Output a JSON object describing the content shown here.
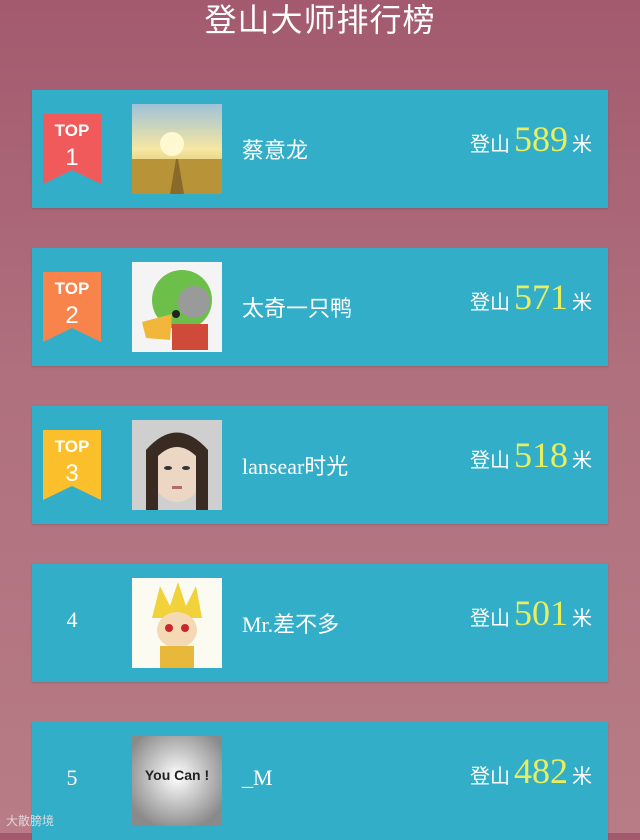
{
  "page_title": "登山大师排行榜",
  "score_prefix": "登山",
  "score_unit": "米",
  "top_label": "TOP",
  "watermark": "大散膀境",
  "colors": {
    "card": "#33aec9",
    "score": "#e8ef5f",
    "rank1": "#f15a5a",
    "rank2": "#f8844b",
    "rank3": "#fbbf2c"
  },
  "ranking": [
    {
      "rank": "1",
      "name": "蔡意龙",
      "score": "589",
      "avatar": "sunset-road"
    },
    {
      "rank": "2",
      "name": "太奇一只鸭",
      "score": "571",
      "avatar": "cartoon-duck"
    },
    {
      "rank": "3",
      "name": "lansear时光",
      "score": "518",
      "avatar": "woman-portrait"
    },
    {
      "rank": "4",
      "name": "Mr.差不多",
      "score": "501",
      "avatar": "anime-boy"
    },
    {
      "rank": "5",
      "name": "_M",
      "score": "482",
      "avatar": "you-can-text",
      "avatar_text": "You Can !"
    }
  ]
}
